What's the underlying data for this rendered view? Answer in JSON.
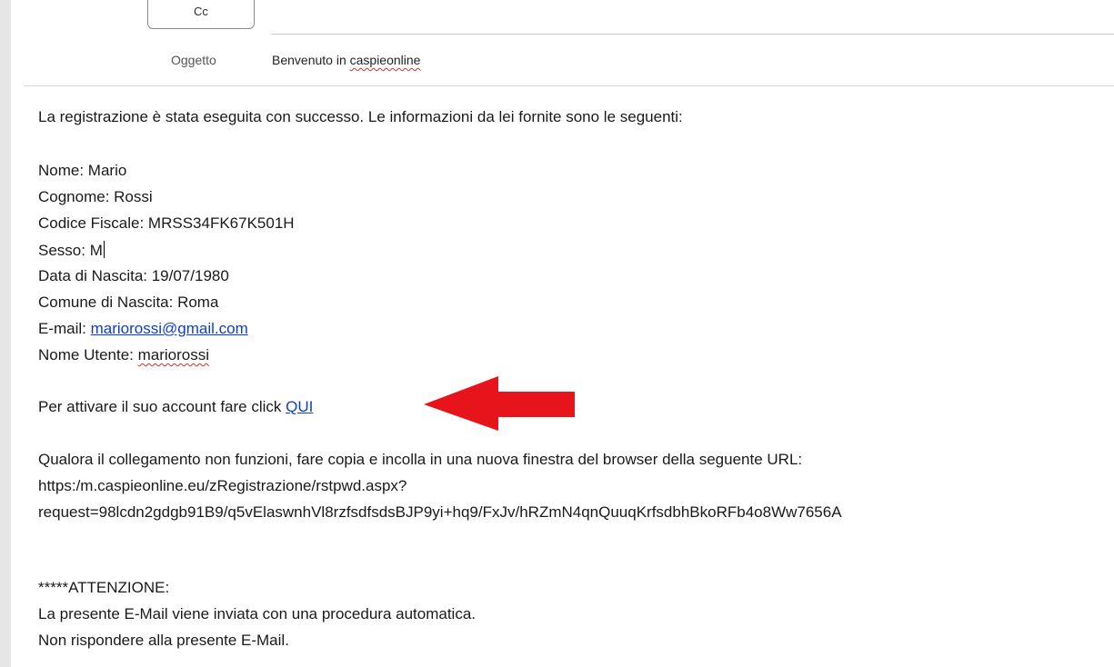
{
  "compose": {
    "cc_label": "Cc",
    "subject_label": "Oggetto",
    "subject_value_prefix": "Benvenuto in ",
    "subject_value_brand": "caspieonline"
  },
  "email": {
    "intro": "La registrazione è stata eseguita con successo. Le informazioni da lei fornite sono le seguenti:",
    "nome": "Nome: Mario",
    "cognome": "Cognome: Rossi",
    "codice_fiscale": "Codice Fiscale: MRSS34FK67K501H",
    "sesso": "Sesso: M",
    "data_nascita": "Data di Nascita: 19/07/1980",
    "comune_nascita": "Comune di Nascita: Roma",
    "email_label": "E-mail: ",
    "email_value": "mariorossi@gmail.com",
    "username_label": "Nome Utente: ",
    "username_value": "mariorossi",
    "activate_text": "Per attivare il suo account fare click ",
    "activate_link": "QUI",
    "fallback_text": "Qualora il collegamento non funzioni, fare copia e incolla in una nuova finestra del browser della seguente URL:",
    "url_line1": "https:/m.caspieonline.eu/zRegistrazione/rstpwd.aspx?",
    "url_line2": "request=98lcdn2gdgb91B9/q5vElaswnhVl8rzfsdfsdsBJP9yi+hq9/FxJv/hRZmN4qnQuuqKrfsdbhBkoRFb4o8Ww7656A",
    "attention_title": "*****ATTENZIONE:",
    "attention_line1": "La presente E-Mail viene inviata con una procedura automatica.",
    "attention_line2": "Non rispondere alla presente E-Mail."
  },
  "colors": {
    "link": "#0b3ed6",
    "arrow": "#e8141c"
  },
  "icons": {
    "annotation": "red-arrow-left-icon"
  }
}
